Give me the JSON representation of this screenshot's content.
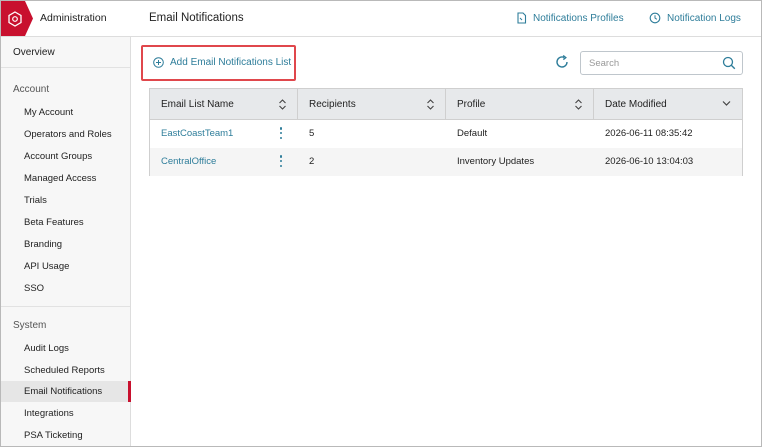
{
  "colors": {
    "accent": "#2e7d9a",
    "brand_red": "#c8102e",
    "highlight_border": "#e0474c"
  },
  "sidebar": {
    "title": "Administration",
    "overview": "Overview",
    "sections": [
      {
        "label": "Account",
        "items": [
          "My Account",
          "Operators and Roles",
          "Account Groups",
          "Managed Access",
          "Trials",
          "Beta Features",
          "Branding",
          "API Usage",
          "SSO"
        ]
      },
      {
        "label": "System",
        "items": [
          "Audit Logs",
          "Scheduled Reports",
          "Email Notifications",
          "Integrations",
          "PSA Ticketing"
        ]
      }
    ],
    "active_item": "Email Notifications"
  },
  "header": {
    "title": "Email Notifications",
    "links": [
      {
        "label": "Notifications Profiles",
        "icon": "document-icon"
      },
      {
        "label": "Notification Logs",
        "icon": "clock-icon"
      }
    ]
  },
  "toolbar": {
    "add_label": "Add Email Notifications List",
    "search_placeholder": "Search",
    "search_value": ""
  },
  "table": {
    "columns": [
      "Email List Name",
      "Recipients",
      "Profile",
      "Date Modified"
    ],
    "rows": [
      {
        "name": "EastCoastTeam1",
        "recipients": "5",
        "profile": "Default",
        "date_modified": "2026-06-11 08:35:42"
      },
      {
        "name": "CentralOffice",
        "recipients": "2",
        "profile": "Inventory Updates",
        "date_modified": "2026-06-10 13:04:03"
      }
    ]
  }
}
